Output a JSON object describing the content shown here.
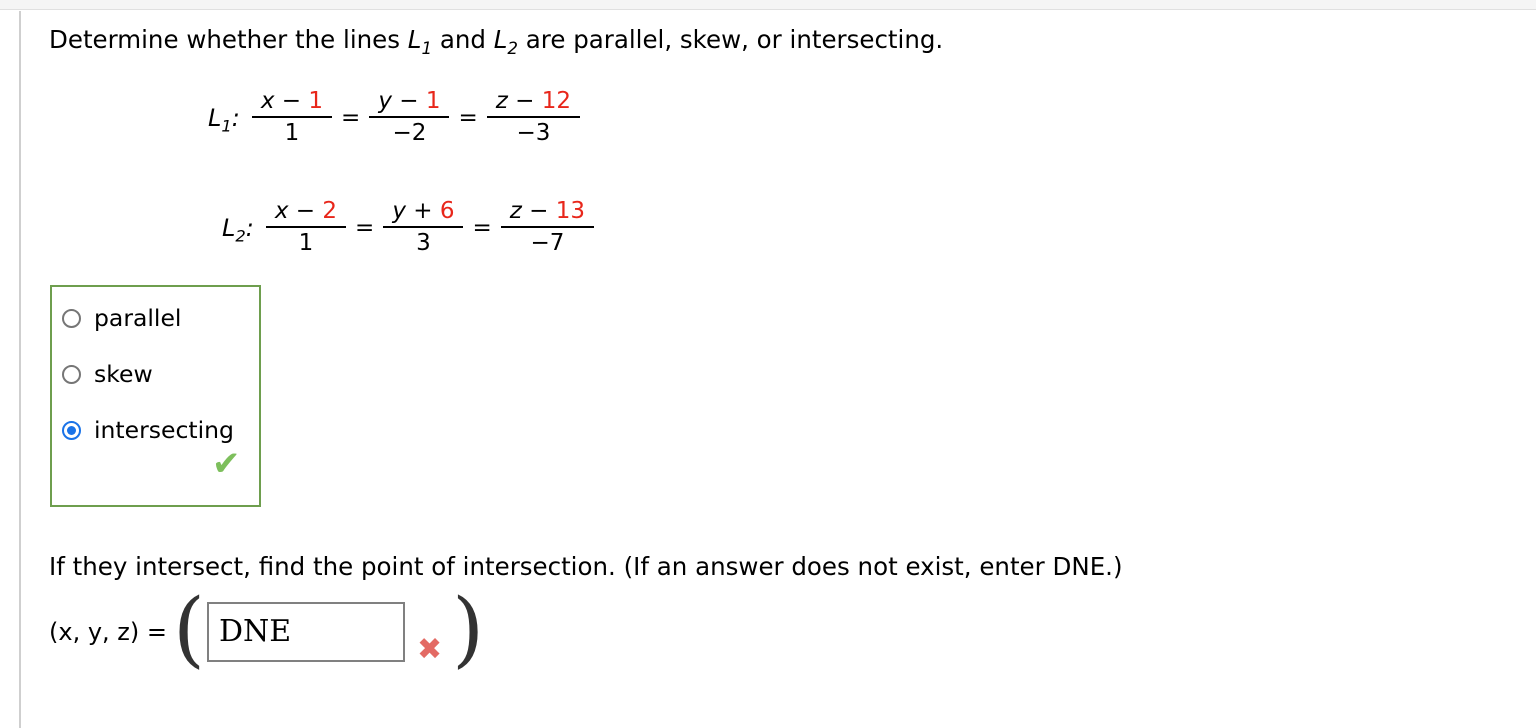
{
  "page": {
    "background": "#ffffff",
    "top_band_color": "#f5f5f5",
    "accent_red": "#e8261a",
    "accent_green": "#6e9e4e",
    "accent_blue": "#1a73e8"
  },
  "prompt": {
    "part_a_1": "Determine whether the lines ",
    "part_a_L1": "L",
    "part_a_L1_sub": "1",
    "part_a_2": " and ",
    "part_a_L2": "L",
    "part_a_L2_sub": "2",
    "part_a_3": " are parallel, skew, or intersecting.",
    "part_b": "If they intersect, find the point of intersection. (If an answer does not exist, enter DNE.)"
  },
  "equations": [
    {
      "label": "L",
      "label_sub": "1",
      "colon": ":",
      "terms": [
        {
          "num_var": "x",
          "num_op": " − ",
          "num_const": "1",
          "den": "1"
        },
        {
          "num_var": "y",
          "num_op": " − ",
          "num_const": "1",
          "den": "−2"
        },
        {
          "num_var": "z",
          "num_op": " − ",
          "num_const": "12",
          "den": "−3"
        }
      ],
      "equals": "="
    },
    {
      "label": "L",
      "label_sub": "2",
      "colon": ":",
      "terms": [
        {
          "num_var": "x",
          "num_op": " − ",
          "num_const": "2",
          "den": "1"
        },
        {
          "num_var": "y",
          "num_op": " + ",
          "num_const": "6",
          "den": "3"
        },
        {
          "num_var": "z",
          "num_op": " − ",
          "num_const": "13",
          "den": "−7"
        }
      ],
      "equals": "="
    }
  ],
  "choices": {
    "options": [
      {
        "label": "parallel",
        "selected": false
      },
      {
        "label": "skew",
        "selected": false
      },
      {
        "label": "intersecting",
        "selected": true
      }
    ],
    "feedback_icon": "✔",
    "feedback_icon_name": "correct-check-icon"
  },
  "answer": {
    "coord_label": "(x, y, z) =",
    "paren_left": "(",
    "paren_right": ")",
    "input_value": "DNE",
    "input_placeholder": "",
    "feedback_icon": "✖",
    "feedback_icon_name": "incorrect-cross-icon"
  }
}
